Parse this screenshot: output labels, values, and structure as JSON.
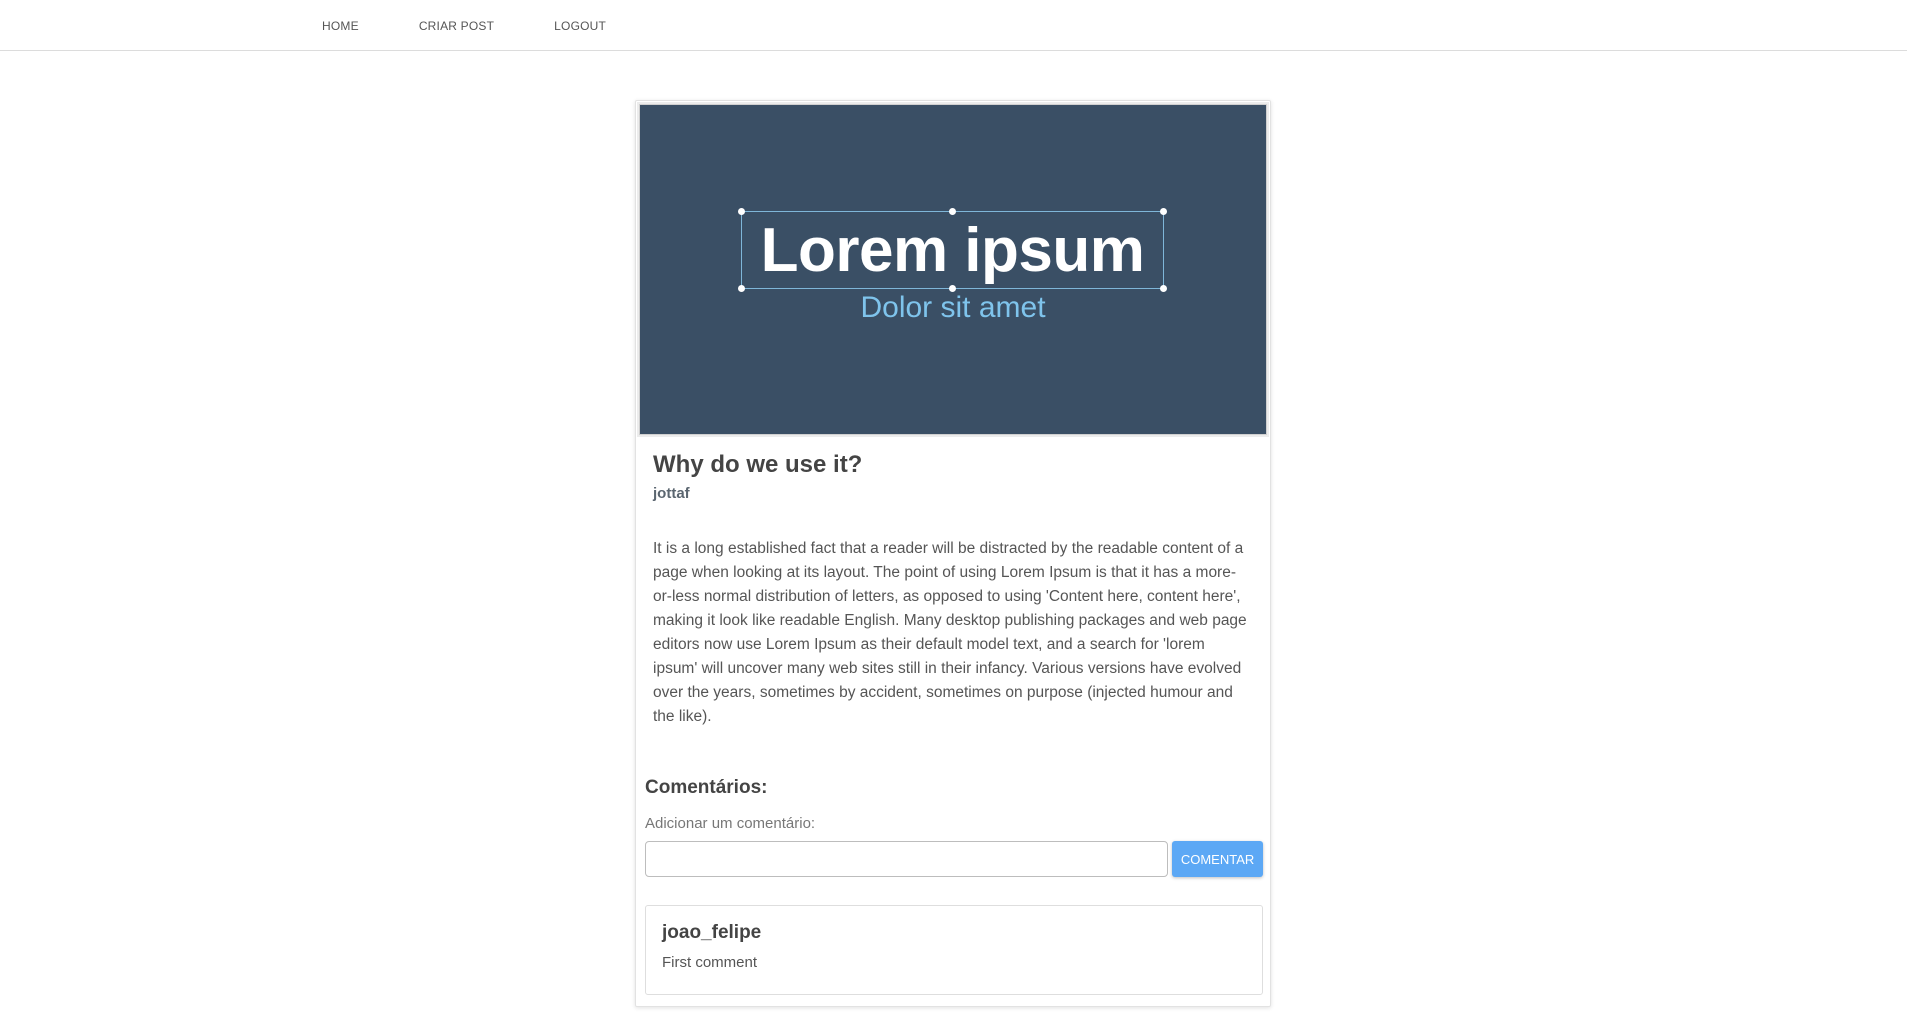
{
  "nav": {
    "home": "HOME",
    "create_post": "CRIAR POST",
    "logout": "LOGOUT"
  },
  "post": {
    "cover_title": "Lorem ipsum",
    "cover_subtitle": "Dolor sit amet",
    "title": "Why do we use it?",
    "author": "jottaf",
    "content": "It is a long established fact that a reader will be distracted by the readable content of a page when looking at its layout. The point of using Lorem Ipsum is that it has a more-or-less normal distribution of letters, as opposed to using 'Content here, content here', making it look like readable English. Many desktop publishing packages and web page editors now use Lorem Ipsum as their default model text, and a search for 'lorem ipsum' will uncover many web sites still in their infancy. Various versions have evolved over the years, sometimes by accident, sometimes on purpose (injected humour and the like)."
  },
  "comments": {
    "heading": "Comentários:",
    "add_label": "Adicionar um comentário:",
    "input_value": "",
    "input_placeholder": "",
    "submit_label": "COMENTAR",
    "items": [
      {
        "author": "joao_felipe",
        "text": "First comment"
      }
    ]
  },
  "colors": {
    "cover_bg": "#3a4f65",
    "cover_subtitle": "#7fc4ec",
    "button_bg": "#5ca8f5"
  }
}
